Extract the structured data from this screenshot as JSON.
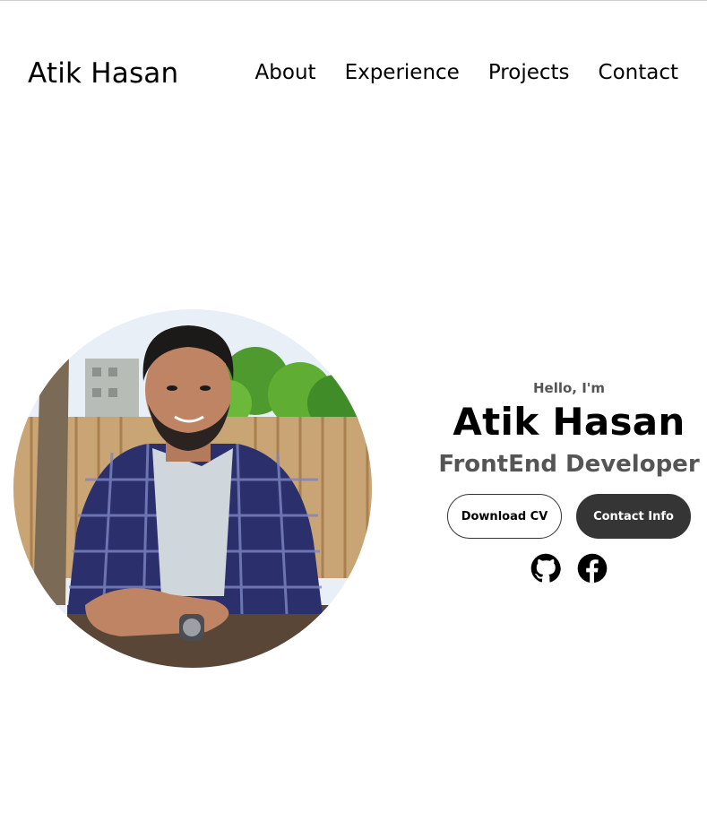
{
  "header": {
    "logo": "Atik Hasan",
    "nav": [
      {
        "label": "About"
      },
      {
        "label": "Experience"
      },
      {
        "label": "Projects"
      },
      {
        "label": "Contact"
      }
    ]
  },
  "hero": {
    "greeting": "Hello, I'm",
    "name": "Atik Hasan",
    "role": "FrontEnd Developer",
    "buttons": {
      "download_cv": "Download CV",
      "contact_info": "Contact Info"
    },
    "social": [
      {
        "icon": "github-icon"
      },
      {
        "icon": "facebook-icon"
      }
    ]
  },
  "colors": {
    "dark_button": "#353535",
    "secondary_text": "#555555"
  }
}
